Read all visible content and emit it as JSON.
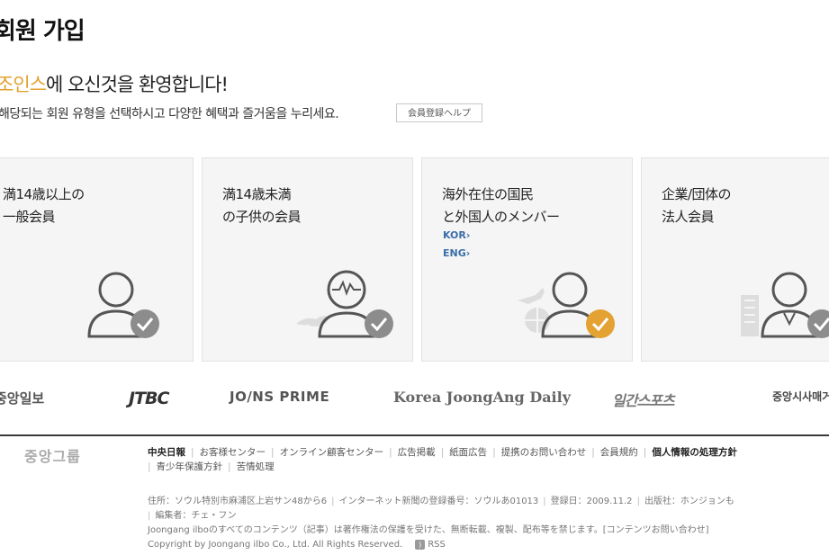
{
  "header": {
    "title": "회원 가입",
    "welcome_brand": "조인스",
    "welcome_text": "에 오신것을 환영합니다!",
    "subtitle": "해당되는 회원 유형을 선택하시고 다양한 혜택과 즐거움을 누리세요.",
    "help_label": "会員登録ヘルプ"
  },
  "cards": [
    {
      "title": "満14歳以上の\n一般会員",
      "icon": "person-check-icon"
    },
    {
      "title": "満14歳未満\nの子供の会員",
      "icon": "child-check-icon"
    },
    {
      "title": "海外在住の国民\nと外国人のメンバー",
      "icon": "globe-person-check-icon",
      "links": [
        "KOR›",
        "ENG›"
      ]
    },
    {
      "title": "企業/団体の\n法人会員",
      "icon": "building-person-check-icon"
    }
  ],
  "brands": [
    "중앙일보",
    "JTBC",
    "JO/NS PRIME",
    "Korea JoongAng Daily",
    "일간스포츠",
    "중앙시사매거진"
  ],
  "footer": {
    "group_name": "중앙그룹",
    "links": [
      {
        "label": "中央日報",
        "bold": true
      },
      {
        "label": "お客様センター"
      },
      {
        "label": "オンライン顧客センター"
      },
      {
        "label": "広告掲載"
      },
      {
        "label": "紙面広告"
      },
      {
        "label": "提携のお問い合わせ"
      },
      {
        "label": "会員規約"
      },
      {
        "label": "個人情報の処理方針",
        "bold": true
      },
      {
        "label": "青少年保護方針"
      },
      {
        "label": "苦情処理"
      }
    ],
    "address": "住所：ソウル特別市麻浦区上岩サン48から6",
    "registration": "インターネット新聞の登録番号：ソウルあ01013",
    "registered_date": "登録日：2009.11.2",
    "publisher": "出版社：ホンジョンも",
    "editor": "編集者：チェ・フン",
    "copyright_notice": "Joongang ilboのすべてのコンテンツ（記事）は著作権法の保護を受けた、無断転載、複製、配布等を禁じます。[コンテンツお問い合わせ]",
    "copyright": "Copyright by Joongang ilbo Co., Ltd. All Rights Reserved.",
    "rss_label": "RSS"
  },
  "colors": {
    "accent": "#e3a232",
    "check_gray": "#8c8c8c",
    "link_blue": "#3a6ea8"
  }
}
